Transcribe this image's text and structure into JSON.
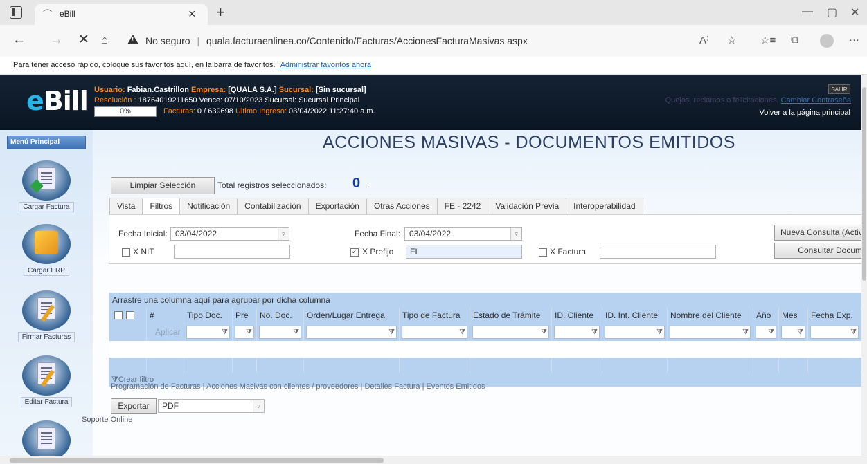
{
  "browser": {
    "tab_title": "eBill",
    "tab_close": "×",
    "new_tab": "+",
    "security": "No seguro",
    "separator": "|",
    "url": "quala.facturaenlinea.co/Contenido/Facturas/AccionesFacturaMasivas.aspx"
  },
  "favbar": {
    "text": "Para tener acceso rápido, coloque sus favoritos aquí, en la barra de favoritos.",
    "link": "Administrar favoritos ahora"
  },
  "header": {
    "logo_e": "e",
    "logo_rest": "Bill",
    "usuario_label": "Usuario:",
    "usuario_value": "Fabian.Castrillon",
    "empresa_label": "Empresa:",
    "empresa_value": "[QUALA S.A.]",
    "sucursal_label": "Sucursal:",
    "sucursal_value": "[Sin sucursal]",
    "resolucion_label": "Resolución :",
    "resolucion_value": "18764019211650 Vence: 07/10/2023 Sucursal: Sucursal Principal",
    "progress": "0%",
    "facturas_label": "Facturas:",
    "facturas_value": "0 / 639698",
    "ultimo_label": "Ultimo Ingreso:",
    "ultimo_value": "03/04/2022 11:27:40 a.m.",
    "quejas": "Quejas, reclamos o felicitaciones.",
    "cambiar": "Cambiar Contraseña",
    "salir": "SALIR",
    "volver": "Volver a la página principal"
  },
  "menu": {
    "title": "Menú Principal",
    "items": [
      {
        "label": "Cargar Factura",
        "icon": "upload-invoice-icon"
      },
      {
        "label": "Cargar ERP",
        "icon": "erp-package-icon"
      },
      {
        "label": "Firmar Facturas",
        "icon": "sign-invoice-icon"
      },
      {
        "label": "Editar Factura",
        "icon": "edit-invoice-icon"
      }
    ],
    "soporte": "Soporte Online"
  },
  "page": {
    "title": "ACCIONES MASIVAS - DOCUMENTOS EMITIDOS",
    "limpiar": "Limpiar Selección",
    "total_label": "Total registros seleccionados:",
    "total_count": "0",
    "total_dot": ".",
    "tabs": [
      "Vista",
      "Filtros",
      "Notificación",
      "Contabilización",
      "Exportación",
      "Otras Acciones",
      "FE - 2242",
      "Validación Previa",
      "Interoperabilidad"
    ]
  },
  "filters": {
    "fecha_inicial_label": "Fecha Inicial:",
    "fecha_inicial_value": "03/04/2022",
    "fecha_final_label": "Fecha Final:",
    "fecha_final_value": "03/04/2022",
    "nit_label": "X NIT",
    "nit_value": "",
    "prefijo_label": "X Prefijo",
    "prefijo_value": "FI",
    "prefijo_checked": "✓",
    "factura_label": "X Factura",
    "factura_value": "",
    "nueva_consulta": "Nueva Consulta (Activ",
    "consultar": "Consultar Docum",
    "dropdown_arrow": "▿"
  },
  "grid": {
    "group_bar": "Arrastre una columna aquí para agrupar por dicha columna",
    "columns": [
      "#",
      "Tipo Doc.",
      "Pre",
      "No. Doc.",
      "Orden/Lugar Entrega",
      "Tipo de Factura",
      "Estado de Trámite",
      "ID. Cliente",
      "ID. Int. Cliente",
      "Nombre del Cliente",
      "Año",
      "Mes",
      "Fecha Exp."
    ],
    "aplicar": "Aplicar",
    "filter_icon": "⧩",
    "crear_filtro": "Crear filtro",
    "crear_icon": "⧩"
  },
  "footer": {
    "links": "Programación de Facturas   |  Acciones Masivas con clientes / proveedores   |  Detalles Factura   |  Eventos Emitidos",
    "exportar": "Exportar",
    "export_format": "PDF"
  }
}
